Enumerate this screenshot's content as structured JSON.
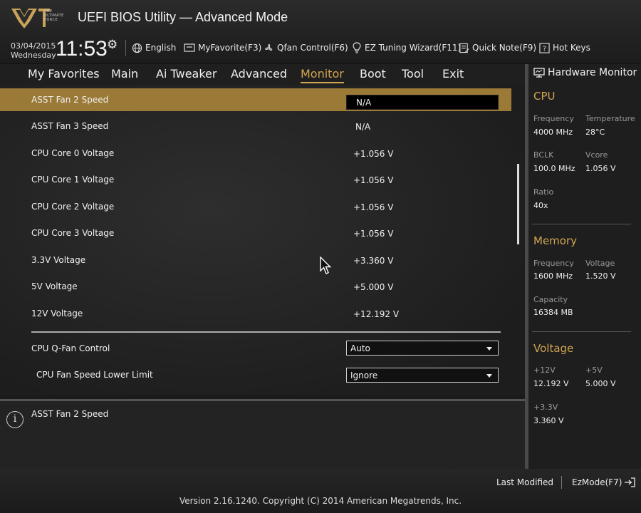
{
  "header": {
    "title": "UEFI BIOS Utility — Advanced Mode",
    "logo_text": "THE ULTIMATE FORCE",
    "date": "03/04/2015",
    "day": "Wednesday",
    "time": "11:53",
    "toolbar": [
      {
        "label": "English",
        "icon": "globe-icon"
      },
      {
        "label": "MyFavorite(F3)",
        "icon": "favorite-screen-icon"
      },
      {
        "label": "Qfan Control(F6)",
        "icon": "fan-icon"
      },
      {
        "label": "EZ Tuning Wizard(F11)",
        "icon": "lightbulb-icon"
      },
      {
        "label": "Quick Note(F9)",
        "icon": "note-icon"
      },
      {
        "label": "Hot Keys",
        "icon": "question-icon"
      }
    ]
  },
  "nav": {
    "tabs": [
      "My Favorites",
      "Main",
      "Ai Tweaker",
      "Advanced",
      "Monitor",
      "Boot",
      "Tool",
      "Exit"
    ],
    "active": "Monitor"
  },
  "main": {
    "rows": [
      {
        "label": "ASST Fan 2 Speed",
        "value": "N/A"
      },
      {
        "label": "ASST Fan 3 Speed",
        "value": "N/A"
      },
      {
        "label": "CPU Core 0 Voltage",
        "value": "+1.056 V"
      },
      {
        "label": "CPU Core 1 Voltage",
        "value": "+1.056 V"
      },
      {
        "label": "CPU Core 2 Voltage",
        "value": "+1.056 V"
      },
      {
        "label": "CPU Core 3 Voltage",
        "value": "+1.056 V"
      },
      {
        "label": "3.3V Voltage",
        "value": "+3.360 V"
      },
      {
        "label": "5V Voltage",
        "value": "+5.000 V"
      },
      {
        "label": "12V Voltage",
        "value": "+12.192 V"
      }
    ],
    "settings": [
      {
        "label": "CPU Q-Fan Control",
        "value": "Auto"
      },
      {
        "label": "CPU Fan Speed Lower Limit",
        "value": "Ignore"
      }
    ]
  },
  "help": {
    "text": "ASST Fan 2 Speed"
  },
  "hw_monitor": {
    "title": "Hardware Monitor",
    "cpu": {
      "heading": "CPU",
      "frequency_label": "Frequency",
      "frequency": "4000 MHz",
      "temperature_label": "Temperature",
      "temperature": "28°C",
      "bclk_label": "BCLK",
      "bclk": "100.0 MHz",
      "vcore_label": "Vcore",
      "vcore": "1.056 V",
      "ratio_label": "Ratio",
      "ratio": "40x"
    },
    "memory": {
      "heading": "Memory",
      "frequency_label": "Frequency",
      "frequency": "1600 MHz",
      "voltage_label": "Voltage",
      "voltage": "1.520 V",
      "capacity_label": "Capacity",
      "capacity": "16384 MB"
    },
    "voltage": {
      "heading": "Voltage",
      "v12_label": "+12V",
      "v12": "12.192 V",
      "v5_label": "+5V",
      "v5": "5.000 V",
      "v33_label": "+3.3V",
      "v33": "3.360 V"
    }
  },
  "footer": {
    "last_modified": "Last Modified",
    "ezmode": "EzMode(F7)",
    "version": "Version 2.16.1240. Copyright (C) 2014 American Megatrends, Inc."
  },
  "colors": {
    "accent": "#d1a552",
    "selected_row": "#9a7a36"
  }
}
